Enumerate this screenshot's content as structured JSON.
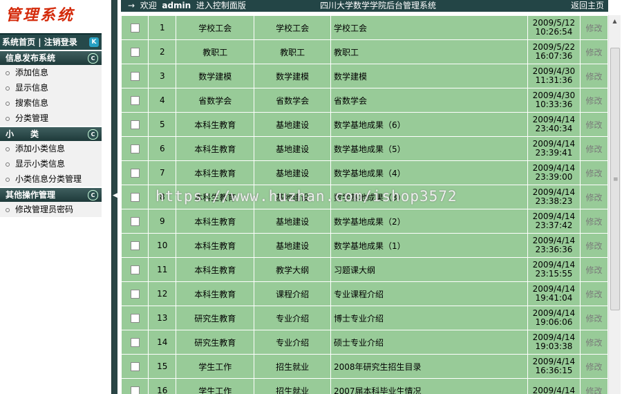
{
  "logo": "管理系统",
  "topnav": {
    "home": "系统首页",
    "sep": " | ",
    "logout": "注销登录",
    "button": "K"
  },
  "sections": [
    {
      "title": "信息发布系统",
      "items": [
        "添加信息",
        "显示信息",
        "搜索信息",
        "分类管理"
      ]
    },
    {
      "title": "小　　类",
      "items": [
        "添加小类信息",
        "显示小类信息",
        "小类信息分类管理"
      ]
    },
    {
      "title": "其他操作管理",
      "items": [
        "修改管理员密码"
      ]
    }
  ],
  "header": {
    "welcome_arrow": "→",
    "welcome": "欢迎",
    "user": "admin",
    "enter": "进入控制面版",
    "title": "四川大学数学学院后台管理系统",
    "home_link": "返回主页"
  },
  "edit_label": "修改",
  "rows": [
    {
      "id": "1",
      "cat": "学校工会",
      "sub": "学校工会",
      "title": "学校工会",
      "date": "2009/5/12",
      "time": "10:26:54"
    },
    {
      "id": "2",
      "cat": "教职工",
      "sub": "教职工",
      "title": "教职工",
      "date": "2009/5/22",
      "time": "16:07:36"
    },
    {
      "id": "3",
      "cat": "数学建模",
      "sub": "数学建模",
      "title": "数学建模",
      "date": "2009/4/30",
      "time": "11:31:36"
    },
    {
      "id": "4",
      "cat": "省数学会",
      "sub": "省数学会",
      "title": "省数学会",
      "date": "2009/4/30",
      "time": "10:33:36"
    },
    {
      "id": "5",
      "cat": "本科生教育",
      "sub": "基地建设",
      "title": "数学基地成果（6）",
      "date": "2009/4/14",
      "time": "23:40:34"
    },
    {
      "id": "6",
      "cat": "本科生教育",
      "sub": "基地建设",
      "title": "数学基地成果（5）",
      "date": "2009/4/14",
      "time": "23:39:41"
    },
    {
      "id": "7",
      "cat": "本科生教育",
      "sub": "基地建设",
      "title": "数学基地成果（4）",
      "date": "2009/4/14",
      "time": "23:39:00"
    },
    {
      "id": "8",
      "cat": "本科生教育",
      "sub": "基地建设",
      "title": "数学基地成果（3）",
      "date": "2009/4/14",
      "time": "23:38:23"
    },
    {
      "id": "9",
      "cat": "本科生教育",
      "sub": "基地建设",
      "title": "数学基地成果（2）",
      "date": "2009/4/14",
      "time": "23:37:42"
    },
    {
      "id": "10",
      "cat": "本科生教育",
      "sub": "基地建设",
      "title": "数学基地成果（1）",
      "date": "2009/4/14",
      "time": "23:36:36"
    },
    {
      "id": "11",
      "cat": "本科生教育",
      "sub": "教学大纲",
      "title": "习题课大纲",
      "date": "2009/4/14",
      "time": "23:15:55"
    },
    {
      "id": "12",
      "cat": "本科生教育",
      "sub": "课程介绍",
      "title": "专业课程介绍",
      "date": "2009/4/14",
      "time": "19:41:04"
    },
    {
      "id": "13",
      "cat": "研究生教育",
      "sub": "专业介绍",
      "title": "博士专业介绍",
      "date": "2009/4/14",
      "time": "19:06:06"
    },
    {
      "id": "14",
      "cat": "研究生教育",
      "sub": "专业介绍",
      "title": "硕士专业介绍",
      "date": "2009/4/14",
      "time": "19:03:38"
    },
    {
      "id": "15",
      "cat": "学生工作",
      "sub": "招生就业",
      "title": "2008年研究生招生目录",
      "date": "2009/4/14",
      "time": "16:36:15"
    },
    {
      "id": "16",
      "cat": "学生工作",
      "sub": "招生就业",
      "title": "2007届本科毕业生情况",
      "date": "2009/4/14",
      "time": ""
    }
  ],
  "watermark": "https://www.huzhan.com/ishop3572",
  "colors": {
    "row_bg": "#98cb98",
    "dark_bar": "#234546",
    "logo_red": "#d42a0a"
  }
}
